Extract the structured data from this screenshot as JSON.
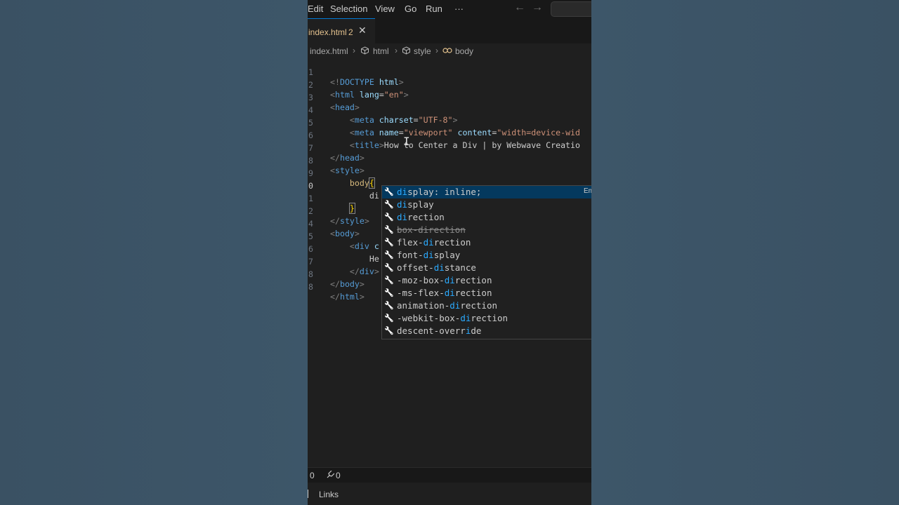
{
  "menu": {
    "items": [
      "Edit",
      "Selection",
      "View",
      "Go",
      "Run"
    ],
    "more": "···",
    "back_arrow": "←",
    "forward_arrow": "→"
  },
  "tab": {
    "label": "index.html",
    "problems_count": "2",
    "close_glyph": "✕"
  },
  "breadcrumb": {
    "items": [
      "index.html",
      "html",
      "style",
      "body"
    ],
    "separator": "›"
  },
  "code": {
    "line_numbers": [
      "1",
      "2",
      "3",
      "4",
      "5",
      "6",
      "7",
      "8",
      "9",
      "0",
      "1",
      "2",
      "4",
      "5",
      "6",
      "7",
      "8"
    ],
    "lines": {
      "l1": {
        "open": "<!",
        "tag": "DOCTYPE",
        "attr": " html",
        "close": ">"
      },
      "l2": {
        "open": "<",
        "tag": "html",
        "attr": " lang",
        "eq": "=",
        "val": "\"en\"",
        "close": ">"
      },
      "l3": {
        "open": "<",
        "tag": "head",
        "close": ">"
      },
      "l4": {
        "indent": "    ",
        "open": "<",
        "tag": "meta",
        "attr": " charset",
        "eq": "=",
        "val": "\"UTF-8\"",
        "close": ">"
      },
      "l5": {
        "indent": "    ",
        "open": "<",
        "tag": "meta",
        "attr": " name",
        "eq": "=",
        "val": "\"viewport\"",
        "attr2": " content",
        "eq2": "=",
        "val2": "\"width=device-wid"
      },
      "l6": {
        "indent": "    ",
        "open": "<",
        "tag": "title",
        "close": ">",
        "text": "How to Center a Div | by Webwave Creatio"
      },
      "l7": {
        "open": "</",
        "tag": "head",
        "close": ">"
      },
      "l8": {
        "open": "<",
        "tag": "style",
        "close": ">"
      },
      "l9": {
        "indent": "    ",
        "selector": "body",
        "brace": "{"
      },
      "l10": {
        "indent": "        ",
        "text": "di"
      },
      "l11": {
        "indent": "    ",
        "brace": "}"
      },
      "l12": {
        "open": "</",
        "tag": "style",
        "close": ">"
      },
      "l14": {
        "open": "<",
        "tag": "body",
        "close": ">"
      },
      "l15": {
        "indent": "    ",
        "open": "<",
        "tag": "div",
        "text": " c"
      },
      "l16": {
        "indent": "        ",
        "text": "He"
      },
      "l17": {
        "indent": "    ",
        "open": "</",
        "tag": "div",
        "close": ">"
      },
      "l18": {
        "open": "</",
        "tag": "body",
        "close": ">"
      },
      "l19": {
        "open": "</",
        "tag": "html",
        "close": ">"
      }
    }
  },
  "suggestions": [
    {
      "match": "di",
      "rest": "splay: inline;",
      "detail": "Em",
      "selected": true
    },
    {
      "match": "di",
      "rest": "splay"
    },
    {
      "match": "di",
      "rest": "rection"
    },
    {
      "pre": "box-direction",
      "deprecated": true
    },
    {
      "pre": "flex-",
      "match": "di",
      "rest": "rection"
    },
    {
      "pre": "font-",
      "match": "di",
      "rest": "splay"
    },
    {
      "pre": "offset-",
      "match": "di",
      "rest": "stance"
    },
    {
      "pre": "-moz-box-",
      "match": "di",
      "rest": "rection"
    },
    {
      "pre": "-ms-flex-",
      "match": "di",
      "rest": "rection"
    },
    {
      "pre": "animation-",
      "match": "di",
      "rest": "rection"
    },
    {
      "pre": "-webkit-box-",
      "match": "di",
      "rest": "rection"
    },
    {
      "pre": "descent-overr",
      "match": "i",
      "rest": "de"
    }
  ],
  "status": {
    "errors": "0",
    "warnings": "0"
  },
  "panel": {
    "links": "Links"
  },
  "colors": {
    "accent": "#0078d4",
    "suggest_selected": "#04395e",
    "match_highlight": "#2aaaff"
  }
}
